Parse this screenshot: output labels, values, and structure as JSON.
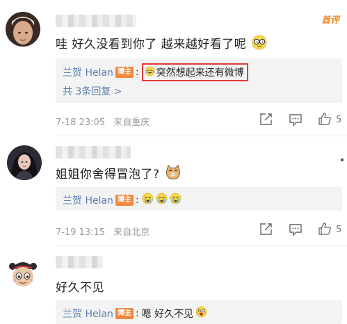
{
  "comments": [
    {
      "first_badge": "首评",
      "text": "哇 好久没看到你了 越来越好看了呢",
      "emoji": "eyeglasses-face-emoji",
      "reply": {
        "author": "兰贺 Helan",
        "host_label": "博主",
        "text": "突然想起来还有微博"
      },
      "more_replies": "共 3条回复 >",
      "date": "7-18 23:05",
      "location": "来自重庆",
      "likes": "5"
    },
    {
      "text": "姐姐你舍得冒泡了?",
      "emoji": "cat-face-emoji",
      "reply": {
        "author": "兰贺 Helan",
        "host_label": "博主",
        "text": ""
      },
      "date": "7-19 13:15",
      "location": "来自北京",
      "likes": "5"
    },
    {
      "text": "好久不见",
      "reply": {
        "author": "兰贺 Helan",
        "host_label": "博主",
        "text": "嗯 好久不见"
      }
    }
  ],
  "colors": {
    "link_blue": "#5b7fb0",
    "host_orange": "#f2883d",
    "highlight_red": "#e03b3b",
    "first_badge": "#f08a1c"
  }
}
